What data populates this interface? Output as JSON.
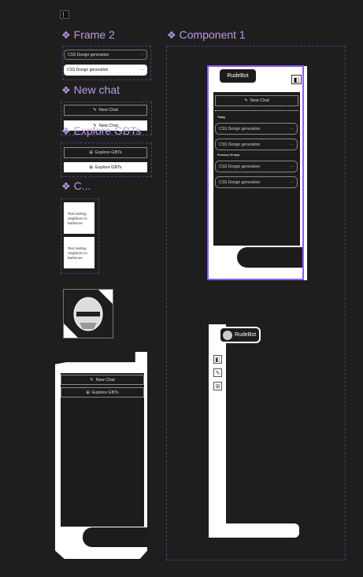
{
  "canvas": {
    "panel_icon": "sidebar-panel-icon"
  },
  "frames": {
    "frame2": {
      "title": "Frame 2",
      "items": [
        "CSS Design generation",
        "CSS Design generation"
      ],
      "more": "···"
    },
    "new_chat": {
      "title": "New chat",
      "buttons": [
        "New Chat",
        "New Chat"
      ]
    },
    "explore": {
      "title": "Explore GBTs",
      "buttons": [
        "Explore GBTs",
        "Explore GBTs"
      ]
    },
    "cards": {
      "title": "C...",
      "items": [
        "Text inviting neighbors to barbecue",
        "Text inviting neighbors to barbecue"
      ]
    },
    "sidebar_left": {
      "new_chat": "New Chat",
      "explore": "Explore GBTs"
    }
  },
  "component1": {
    "title": "Component 1",
    "brand": "RudeBot",
    "new_chat": "New Chat",
    "sections": [
      {
        "label": "Today",
        "items": [
          "CSS Design generation",
          "CSS Design generation"
        ]
      },
      {
        "label": "Previous 30 days",
        "items": [
          "CSS Design generation",
          "CSS Design generation"
        ]
      }
    ],
    "more": "···",
    "collapsed_brand": "RudeBot"
  },
  "colors": {
    "accent": "#8b5cf6",
    "label": "#b89be6",
    "bg": "#1e1e1e"
  }
}
